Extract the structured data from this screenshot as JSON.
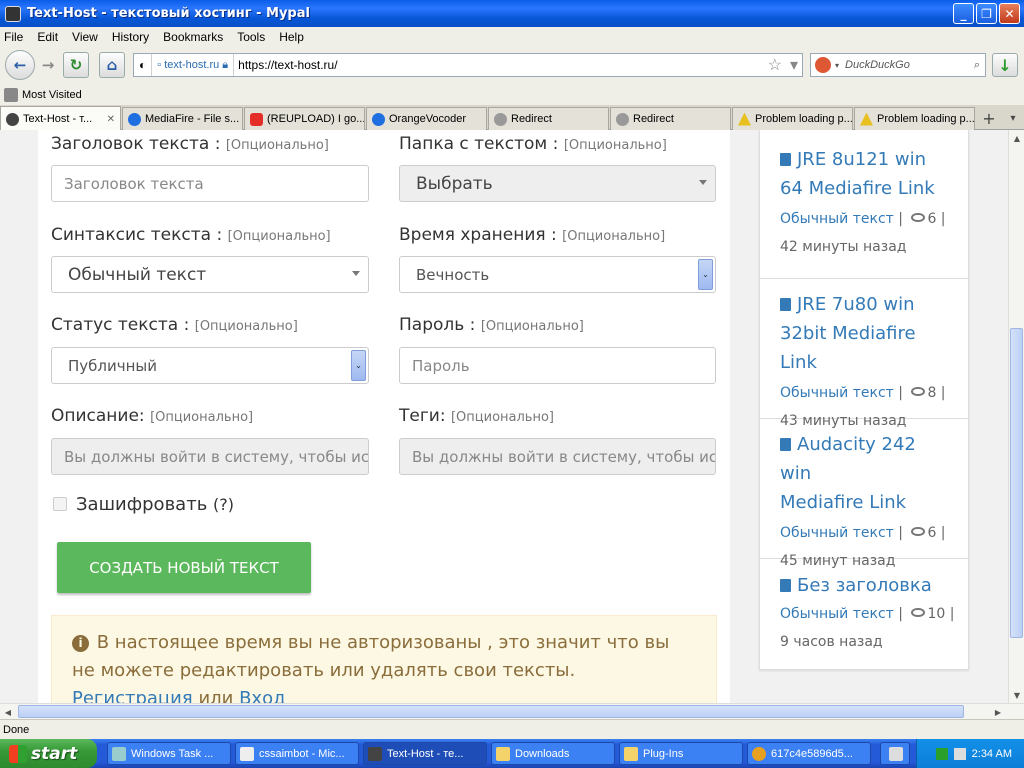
{
  "window": {
    "title": "Text-Host - текстовый хостинг - Mypal"
  },
  "menu": [
    "File",
    "Edit",
    "View",
    "History",
    "Bookmarks",
    "Tools",
    "Help"
  ],
  "navbar": {
    "site_label": "text-host.ru",
    "url": "https://text-host.ru/",
    "search_placeholder": "DuckDuckGo"
  },
  "bookmarks": {
    "most_visited": "Most Visited"
  },
  "tabs": [
    {
      "label": "Text-Host - т...",
      "active": true
    },
    {
      "label": "MediaFire - File s..."
    },
    {
      "label": "(REUPLOAD) I go..."
    },
    {
      "label": "OrangeVocoder"
    },
    {
      "label": "Redirect"
    },
    {
      "label": "Redirect"
    },
    {
      "label": "Problem loading p..."
    },
    {
      "label": "Problem loading p..."
    }
  ],
  "form": {
    "optional": "[Опционально]",
    "title_label": "Заголовок текста :",
    "title_placeholder": "Заголовок текста",
    "folder_label": "Папка с текстом :",
    "folder_value": "Выбрать",
    "syntax_label": "Синтаксис текста :",
    "syntax_value": "Обычный текст",
    "expiry_label": "Время хранения :",
    "expiry_value": "Вечность",
    "status_label": "Статус текста :",
    "status_value": "Публичный",
    "password_label": "Пароль :",
    "password_placeholder": "Пароль",
    "description_label": "Описание:",
    "description_placeholder": "Вы должны войти в систему, чтобы исп",
    "tags_label": "Теги:",
    "tags_placeholder": "Вы должны войти в систему, чтобы исп",
    "encrypt_label": "Зашифровать",
    "encrypt_help": "(?)",
    "create_button": "СОЗДАТЬ НОВЫЙ ТЕКСТ"
  },
  "alert": {
    "icon": "i",
    "text": "В настоящее время вы не авторизованы , это значит что вы не можете редактировать или удалять свои тексты.",
    "register": "Регистрация",
    "or": "или",
    "login": "Вход"
  },
  "recent": [
    {
      "title_lines": [
        "JRE 8u121 win",
        "64 Mediafire Link"
      ],
      "syntax": "Обычный текст",
      "views": "6",
      "time": "42 минуты назад"
    },
    {
      "title_lines": [
        "JRE 7u80 win",
        "32bit Mediafire Link"
      ],
      "syntax": "Обычный текст",
      "views": "8",
      "time": "43 минуты назад"
    },
    {
      "title_lines": [
        "Audacity 242 win",
        "Mediafire Link"
      ],
      "syntax": "Обычный текст",
      "views": "6",
      "time": "45 минут назад"
    },
    {
      "title_lines": [
        "Без заголовка"
      ],
      "syntax": "Обычный текст",
      "views": "10",
      "time": "9 часов назад"
    }
  ],
  "status": {
    "text": "Done"
  },
  "taskbar": {
    "start": "start",
    "items": [
      {
        "label": "Windows Task ..."
      },
      {
        "label": "cssaimbot - Mic..."
      },
      {
        "label": "Text-Host - те...",
        "active": true
      },
      {
        "label": "Downloads"
      },
      {
        "label": "Plug-Ins"
      },
      {
        "label": "617c4e5896d5..."
      }
    ],
    "clock": "2:34 AM"
  },
  "colors": {
    "primary_link": "#337ab7",
    "success": "#5cb85c",
    "warning_bg": "#fcf8e3",
    "warning_text": "#8a6d3b"
  }
}
